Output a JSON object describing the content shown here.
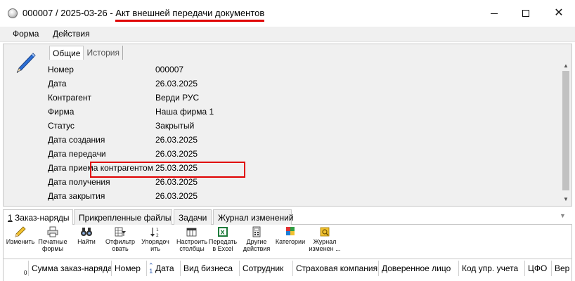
{
  "window": {
    "title_prefix": "000007 / 2025-03-26 - ",
    "title_main": "Акт внешней передачи документов",
    "minimize_symbol": "",
    "close_symbol": "✕"
  },
  "menu": {
    "forma": "Форма",
    "deystviya": "Действия"
  },
  "subtabs": {
    "general": "Общие",
    "history": "История"
  },
  "properties": [
    {
      "label": "Номер",
      "value": "000007"
    },
    {
      "label": "Дата",
      "value": "26.03.2025"
    },
    {
      "label": "Контрагент",
      "value": "Верди РУС"
    },
    {
      "label": "Фирма",
      "value": "Наша фирма 1"
    },
    {
      "label": "Статус",
      "value": "Закрытый"
    },
    {
      "label": "Дата создания",
      "value": "26.03.2025"
    },
    {
      "label": "Дата передачи",
      "value": "26.03.2025"
    },
    {
      "label": "Дата приема контрагентом",
      "value": "25.03.2025"
    },
    {
      "label": "Дата получения",
      "value": "26.03.2025"
    },
    {
      "label": "Дата закрытия",
      "value": "26.03.2025"
    }
  ],
  "bottom_tabs": [
    {
      "label": "1 Заказ-наряды"
    },
    {
      "label": "Прикрепленные файлы"
    },
    {
      "label": "Задачи"
    },
    {
      "label": "Журнал изменений"
    }
  ],
  "toolbar": [
    {
      "label": "Изменить",
      "icon": "pencil-icon"
    },
    {
      "label": "Печатные\nформы",
      "icon": "printer-icon"
    },
    {
      "label": "Найти",
      "icon": "binoculars-icon"
    },
    {
      "label": "Отфильтр\nовать",
      "icon": "filter-icon"
    },
    {
      "label": "Упорядоч\nить",
      "icon": "sort-icon"
    },
    {
      "label": "Настроить\nстолбцы",
      "icon": "columns-icon"
    },
    {
      "label": "Передать\nв Excel",
      "icon": "excel-icon"
    },
    {
      "label": "Другие\nдействия",
      "icon": "calculator-icon"
    },
    {
      "label": "Категории",
      "icon": "categories-icon"
    },
    {
      "label": "Журнал\nизменен ...",
      "icon": "journal-icon"
    }
  ],
  "grid": {
    "row_count": "0",
    "columns": [
      "Сумма заказ-наряда",
      "Номер",
      "Дата",
      "Вид бизнеса",
      "Сотрудник",
      "Страховая компания",
      "Доверенное лицо",
      "Код упр. учета",
      "ЦФО",
      "Вер"
    ]
  },
  "colors": {
    "highlight": "#e00000",
    "panel": "#f0f0f0",
    "sort_arrow": "#2f5db3"
  }
}
